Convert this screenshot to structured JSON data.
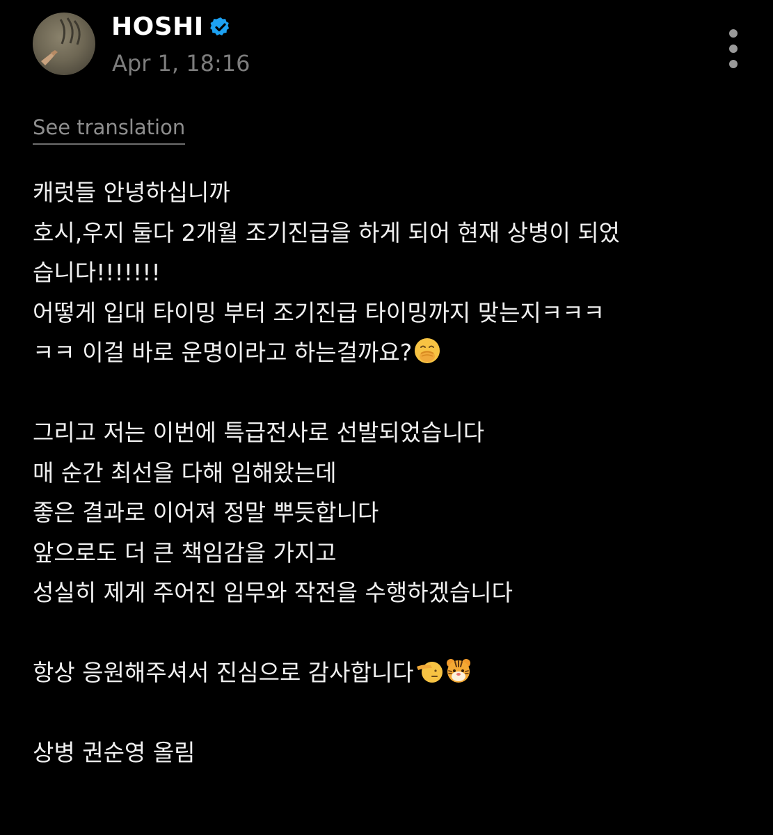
{
  "author": {
    "name": "HOSHI",
    "verified": true,
    "avatar": "avatar-photo"
  },
  "post": {
    "timestamp": "Apr 1, 18:16",
    "translate_link": "See translation",
    "menu_icon": "more-vertical-icon",
    "lines": [
      "캐럿들 안녕하십니까",
      "호시,우지 둘다 2개월 조기진급을 하게 되어 현재 상병이 되었",
      "습니다!!!!!!!",
      "어떻게 입대 타이밍 부터 조기진급 타이밍까지 맞는지ㅋㅋㅋ",
      "ㅋㅋ 이걸 바로 운명이라고 하는걸까요?",
      "",
      "그리고 저는 이번에 특급전사로 선발되었습니다",
      "매 순간 최선을 다해 임해왔는데",
      "좋은 결과로 이어져 정말 뿌듯합니다",
      "앞으로도 더 큰 책임감을 가지고",
      "성실히 제게 주어진 임무와 작전을 수행하겠습니다",
      "",
      "항상 응원해주셔서 진심으로 감사합니다",
      "",
      "상병 권순영 올림"
    ],
    "emojis": {
      "line4": "hand-over-mouth-emoji",
      "line12a": "saluting-face-emoji",
      "line12b": "tiger-face-emoji"
    }
  },
  "colors": {
    "background": "#000000",
    "text": "#f0f0f0",
    "muted": "#7d7d7d",
    "verified": "#1da1f2"
  }
}
